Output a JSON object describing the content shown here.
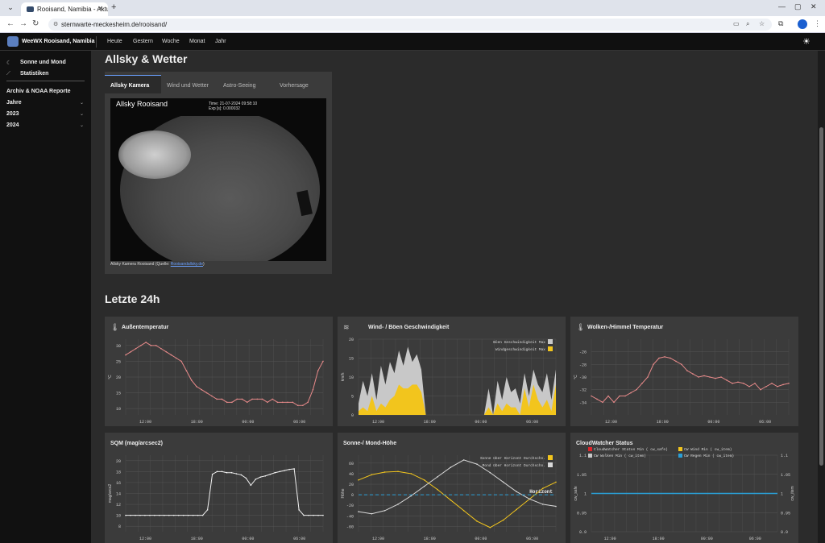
{
  "browser": {
    "tab_title": "Rooisand, Namibia - Aktuelle W",
    "url": "sternwarte-meckesheim.de/rooisand/"
  },
  "site": {
    "brand": "WeeWX Rooisand, Namibia",
    "nav": [
      "Heute",
      "Gestern",
      "Woche",
      "Monat",
      "Jahr"
    ]
  },
  "sidebar": {
    "links": [
      {
        "label": "Sonne und Mond",
        "icon": "moon-icon"
      },
      {
        "label": "Statistiken",
        "icon": "chart-icon"
      }
    ],
    "reports_title": "Archiv & NOAA Reporte",
    "groups": [
      "Jahre",
      "2023",
      "2024"
    ]
  },
  "allsky": {
    "section_title": "Allsky & Wetter",
    "tabs": [
      "Allsky Kamera",
      "Wind und Wetter",
      "Astro-Seeing",
      "Vorhersage"
    ],
    "camera_title": "Allsky Rooisand",
    "camera_time": "Time: 21-07-2024 09:58:10",
    "camera_exp": "Exp [s]: 0.000032",
    "caption_prefix": "Allsky Kamera Rooisand (Quelle: ",
    "caption_link": "Rooisandallsky.de",
    "caption_suffix": ")"
  },
  "last24": {
    "section_title": "Letzte 24h",
    "cards": {
      "temp": "Außentemperatur",
      "wind": "Wind- / Böen Geschwindigkeit",
      "cloud": "Wolken-/Himmel Temperatur",
      "sqm": "SQM (mag/arcsec2)",
      "sun": "Sonne-/ Mond-Höhe",
      "cw": "CloudWatcher Status"
    }
  },
  "chart_data": [
    {
      "type": "line",
      "id": "temp",
      "ylabel": "°C",
      "xticks": [
        "12:00",
        "18:00",
        "00:00",
        "06:00"
      ],
      "ylim": [
        8,
        32
      ],
      "yticks": [
        10,
        15,
        20,
        25,
        30
      ],
      "color": "#e88a8a",
      "values": [
        27,
        28,
        29,
        30,
        31,
        30,
        30,
        29,
        28,
        27,
        26,
        25,
        22,
        19,
        17,
        16,
        15,
        14,
        13,
        13,
        12,
        12,
        13,
        13,
        12,
        13,
        13,
        13,
        12,
        13,
        12,
        12,
        12,
        12,
        11,
        11,
        12,
        16,
        22,
        25
      ]
    },
    {
      "type": "area",
      "id": "wind",
      "ylabel": "km/h",
      "xticks": [
        "12:00",
        "18:00",
        "00:00",
        "06:00"
      ],
      "ylim": [
        0,
        20
      ],
      "yticks": [
        0,
        5,
        10,
        15,
        20
      ],
      "series": [
        {
          "name": "Böen Geschwindigkeit Max",
          "color": "#c8c8c8",
          "values": [
            3,
            9,
            5,
            11,
            4,
            13,
            8,
            14,
            11,
            17,
            13,
            18,
            14,
            16,
            12,
            0,
            0,
            0,
            0,
            0,
            0,
            0,
            0,
            0,
            0,
            0,
            0,
            0,
            0,
            7,
            0,
            9,
            4,
            10,
            6,
            7,
            3,
            11,
            5,
            12,
            8,
            6,
            11,
            4,
            12
          ]
        },
        {
          "name": "Windgeschwindigkeit Max",
          "color": "#f2c51d",
          "values": [
            1,
            2,
            1,
            5,
            1,
            3,
            2,
            4,
            5,
            8,
            7,
            7,
            8,
            8,
            6,
            0,
            0,
            0,
            0,
            0,
            0,
            0,
            0,
            0,
            0,
            0,
            0,
            0,
            0,
            2,
            0,
            3,
            1,
            3,
            2,
            2,
            0,
            7,
            2,
            8,
            4,
            2,
            4,
            1,
            8
          ]
        }
      ]
    },
    {
      "type": "line",
      "id": "cloud",
      "ylabel": "°C",
      "xticks": [
        "12:00",
        "18:00",
        "00:00",
        "06:00"
      ],
      "ylim": [
        -36,
        -24
      ],
      "yticks": [
        -34,
        -32,
        -30,
        -28,
        -26
      ],
      "color": "#e88a8a",
      "values": [
        -33,
        -33.5,
        -34,
        -33,
        -34,
        -33,
        -33,
        -32.5,
        -32,
        -31,
        -30,
        -28,
        -27,
        -26.8,
        -27,
        -27.5,
        -28,
        -29,
        -29.5,
        -30,
        -29.8,
        -30,
        -30.2,
        -30,
        -30.5,
        -31,
        -30.8,
        -31,
        -31.5,
        -31,
        -32,
        -31.5,
        -31,
        -31.5,
        -31.2,
        -31
      ]
    },
    {
      "type": "line",
      "id": "sqm",
      "ylabel": "mag/arcs2",
      "xticks": [
        "12:00",
        "18:00",
        "00:00",
        "06:00"
      ],
      "ylim": [
        7,
        21
      ],
      "yticks": [
        8,
        10,
        12,
        14,
        16,
        18,
        20
      ],
      "color": "#f0f0f0",
      "values": [
        10,
        10,
        10,
        10,
        10,
        10,
        10,
        10,
        10,
        10,
        10,
        10,
        10,
        10,
        10,
        10,
        10,
        11,
        17.5,
        18,
        18,
        17.8,
        17.8,
        17.6,
        17.4,
        16.8,
        15.5,
        16.6,
        17,
        17.2,
        17.5,
        17.8,
        18,
        18.2,
        18.4,
        18.5,
        11,
        10,
        10,
        10,
        10,
        10
      ]
    },
    {
      "type": "line",
      "id": "sun",
      "ylabel": "Höhe",
      "xticks": [
        "12:00",
        "18:00",
        "00:00",
        "06:00"
      ],
      "ylim": [
        -70,
        75
      ],
      "yticks": [
        -60,
        -40,
        -20,
        0,
        20,
        40,
        60
      ],
      "series": [
        {
          "name": "Sonne über Horizont Durchschn.",
          "color": "#f2c51d",
          "values": [
            28,
            38,
            43,
            44,
            40,
            28,
            10,
            -10,
            -30,
            -50,
            -62,
            -48,
            -28,
            -8,
            12,
            24
          ]
        },
        {
          "name": "Mond über Horizont Durchschn.",
          "color": "#d8d8d8",
          "values": [
            -32,
            -36,
            -30,
            -18,
            -2,
            16,
            34,
            52,
            66,
            58,
            42,
            24,
            6,
            -8,
            -18,
            -22
          ]
        }
      ],
      "annotation": "Horizont"
    },
    {
      "type": "line",
      "id": "cw",
      "ylabel": "cw_safe",
      "y2label": "cw_item",
      "xticks": [
        "12:00",
        "18:00",
        "00:00",
        "06:00"
      ],
      "ylim": [
        0.9,
        1.1
      ],
      "yticks": [
        0.9,
        0.95,
        1,
        1.05,
        1.1
      ],
      "series": [
        {
          "name": "CloudWatcher Status Min ( cw_safe)",
          "color": "#e0242a"
        },
        {
          "name": "CW Wind Min ( cw_item)",
          "color": "#f2c51d"
        },
        {
          "name": "CW Wolken Min ( cw_item)",
          "color": "#c8c8c8"
        },
        {
          "name": "CW Regen Min ( cw_item)",
          "color": "#2a9fd6"
        }
      ],
      "values": [
        1
      ]
    }
  ]
}
